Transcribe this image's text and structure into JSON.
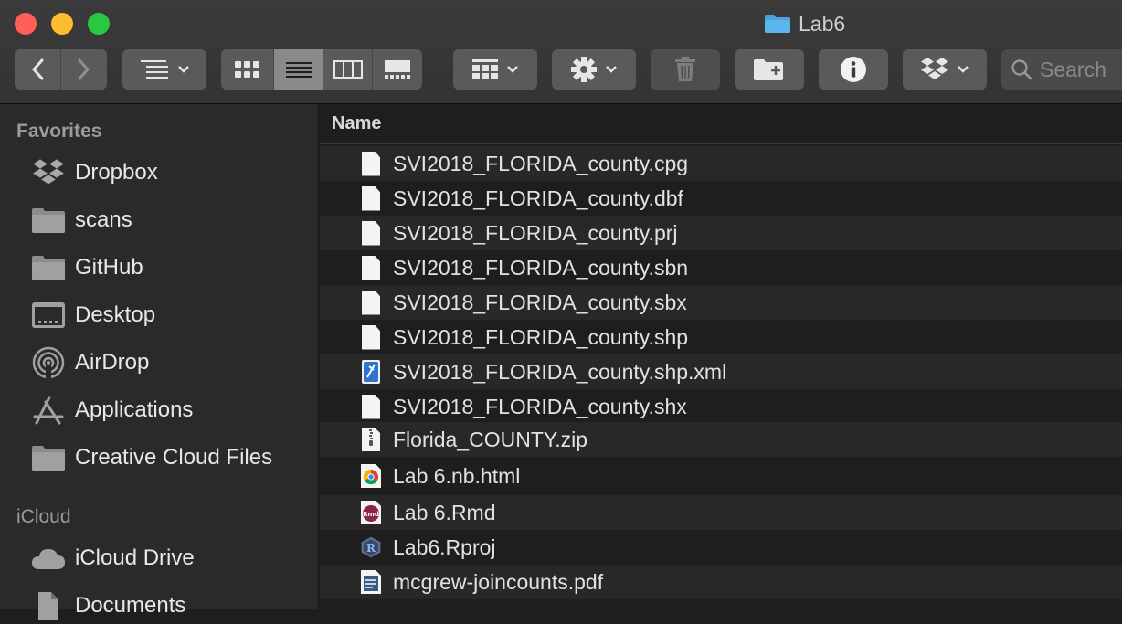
{
  "window": {
    "title": "Lab6"
  },
  "toolbar": {
    "back_icon": "chevron-left-icon",
    "forward_icon": "chevron-right-icon",
    "group_icon": "list-group-icon",
    "views": [
      "icon-view",
      "list-view",
      "column-view",
      "gallery-view"
    ],
    "active_view": "list-view",
    "search_placeholder": "Search"
  },
  "sidebar": {
    "favorites_heading": "Favorites",
    "favorites": [
      {
        "label": "Dropbox",
        "icon": "dropbox-icon"
      },
      {
        "label": "scans",
        "icon": "folder-icon"
      },
      {
        "label": "GitHub",
        "icon": "folder-icon"
      },
      {
        "label": "Desktop",
        "icon": "desktop-icon"
      },
      {
        "label": "AirDrop",
        "icon": "airdrop-icon"
      },
      {
        "label": "Applications",
        "icon": "applications-icon"
      },
      {
        "label": "Creative Cloud Files",
        "icon": "folder-icon"
      }
    ],
    "icloud_heading": "iCloud",
    "icloud": [
      {
        "label": "iCloud Drive",
        "icon": "cloud-icon"
      },
      {
        "label": "Documents",
        "icon": "documents-icon"
      }
    ]
  },
  "list": {
    "column_name": "Name",
    "files": [
      {
        "name": "SVI2018_FLORIDA_county.cpg",
        "icon": "document-icon"
      },
      {
        "name": "SVI2018_FLORIDA_county.dbf",
        "icon": "document-icon"
      },
      {
        "name": "SVI2018_FLORIDA_county.prj",
        "icon": "document-icon"
      },
      {
        "name": "SVI2018_FLORIDA_county.sbn",
        "icon": "document-icon"
      },
      {
        "name": "SVI2018_FLORIDA_county.sbx",
        "icon": "document-icon"
      },
      {
        "name": "SVI2018_FLORIDA_county.shp",
        "icon": "document-icon"
      },
      {
        "name": "SVI2018_FLORIDA_county.shp.xml",
        "icon": "xml-icon"
      },
      {
        "name": "SVI2018_FLORIDA_county.shx",
        "icon": "document-icon"
      },
      {
        "name": "Florida_COUNTY.zip",
        "icon": "zip-icon"
      },
      {
        "name": "Lab 6.nb.html",
        "icon": "chrome-icon"
      },
      {
        "name": "Lab 6.Rmd",
        "icon": "rmd-icon"
      },
      {
        "name": "Lab6.Rproj",
        "icon": "rproj-icon"
      },
      {
        "name": "mcgrew-joincounts.pdf",
        "icon": "pdf-icon"
      }
    ]
  },
  "colors": {
    "close": "#fe5f57",
    "minimize": "#febc2e",
    "maximize": "#28c840",
    "folder_blue": "#4aa3df",
    "sidebar_bg": "#2a2a2a",
    "list_bg": "#1e1e1e"
  }
}
